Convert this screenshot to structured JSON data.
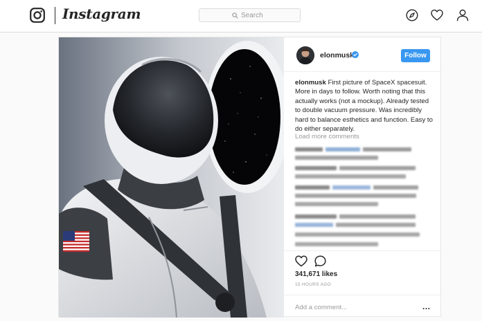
{
  "app": {
    "wordmark": "Instagram",
    "search_placeholder": "Search",
    "nav_icons": [
      "explore-compass-icon",
      "activity-heart-icon",
      "profile-person-icon"
    ]
  },
  "post": {
    "username": "elonmusk",
    "verified": true,
    "follow_label": "Follow",
    "caption_user": "elonmusk",
    "caption_text": "First picture of SpaceX spacesuit. More in days to follow. Worth noting that this actually works (not a mockup). Already tested to double vacuum pressure. Was incredibly hard to balance esthetics and function. Easy to do either separately.",
    "load_more_label": "Load more comments",
    "likes": "341,671 likes",
    "timestamp": "15 HOURS AGO",
    "add_comment_placeholder": "Add a comment...",
    "more_options": "..."
  },
  "colors": {
    "accent": "#3897f0",
    "text": "#262626",
    "muted": "#999999",
    "border": "#dbdbdb"
  }
}
